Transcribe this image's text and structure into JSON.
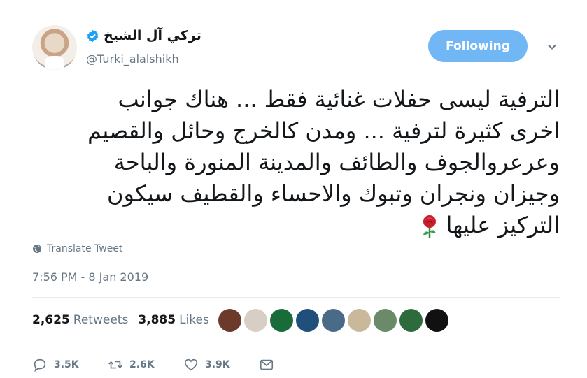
{
  "author": {
    "name": "تركي آل الشيخ",
    "handle": "@Turki_alalshikh"
  },
  "follow_button_label": "Following",
  "tweet_lines": [
    "الترفية ليسى حفلات غنائية فقط ... هناك جوانب",
    "اخرى كثيرة لترفية ... ومدن كالخرج وحائل والقصيم",
    "وعرعروالجوف والطائف والمدينة المنورة والباحة",
    "وجيزان ونجران وتبوك والاحساء والقطيف سيكون",
    "التركيز عليها"
  ],
  "translate_label": "Translate Tweet",
  "timestamp": "7:56 PM - 8 Jan 2019",
  "stats": {
    "retweets_count": "2,625",
    "retweets_label": "Retweets",
    "likes_count": "3,885",
    "likes_label": "Likes"
  },
  "liker_colors": [
    "#6b3a2a",
    "#d8cfc4",
    "#1a6b3a",
    "#1f4f7a",
    "#4a6b88",
    "#c9b89a",
    "#6b8a6a",
    "#2e6b3c",
    "#111111"
  ],
  "actions": {
    "reply_count": "3.5K",
    "retweet_count": "2.6K",
    "like_count": "3.9K"
  },
  "colors": {
    "accent": "#1da1f2",
    "follow_button": "#71b7f5",
    "muted": "#657786"
  }
}
